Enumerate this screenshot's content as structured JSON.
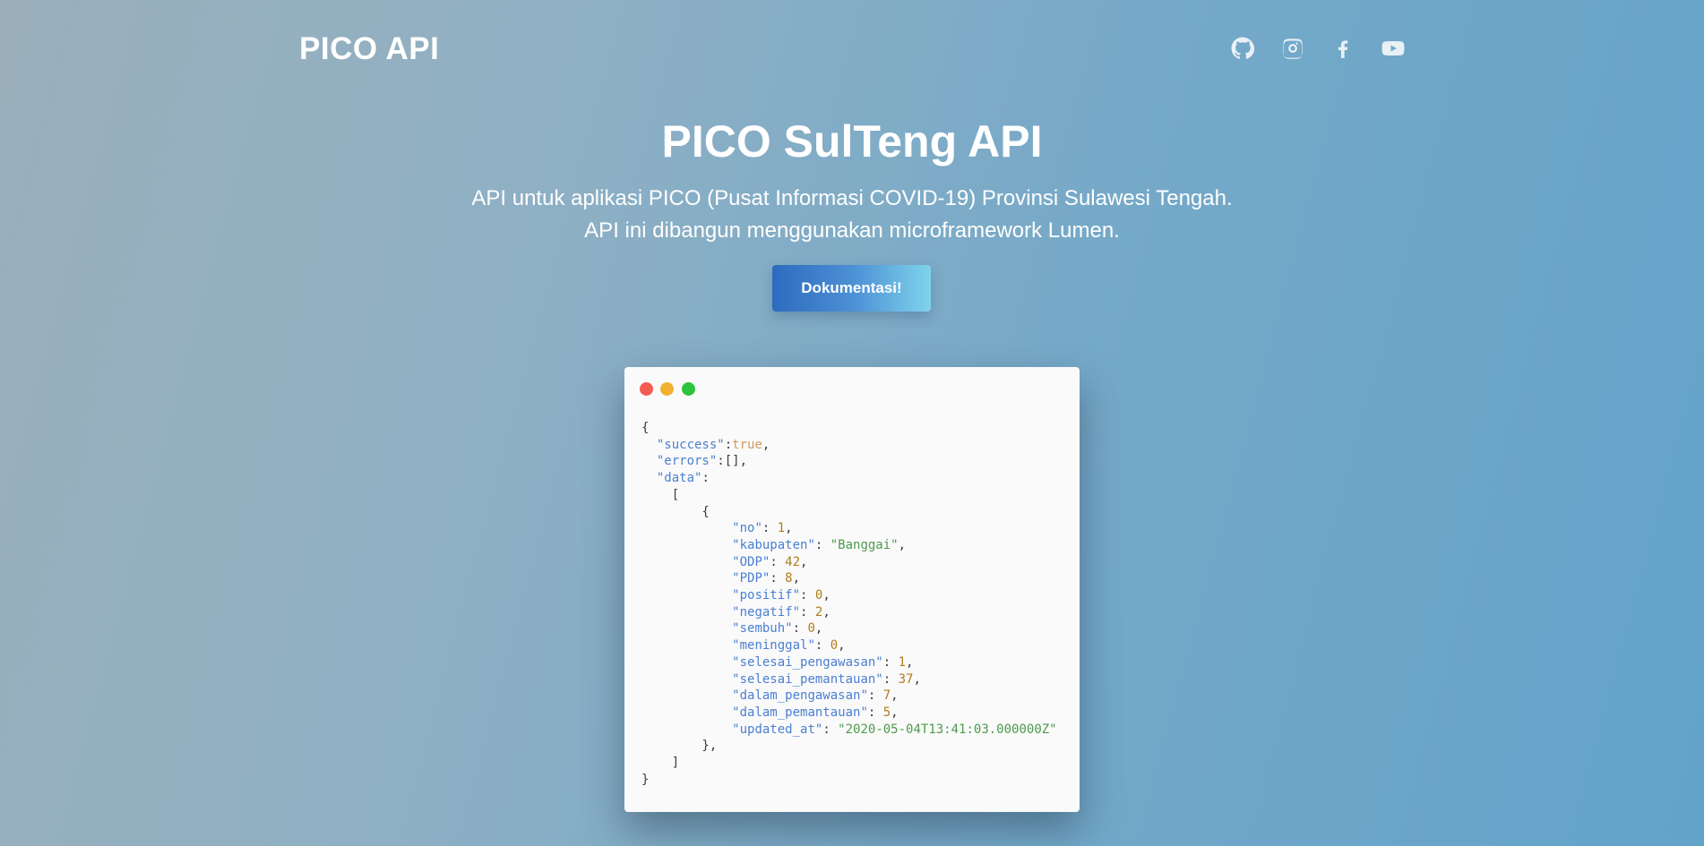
{
  "nav": {
    "brand": "PICO API",
    "social_icons": [
      "github-icon",
      "instagram-icon",
      "facebook-icon",
      "youtube-icon"
    ]
  },
  "hero": {
    "title": "PICO SulTeng API",
    "subtitle_line1": "API untuk aplikasi PICO (Pusat Informasi COVID-19) Provinsi Sulawesi Tengah.",
    "subtitle_line2": "API ini dibangun menggunakan microframework Lumen.",
    "button_label": "Dokumentasi!"
  },
  "colors": {
    "window_close": "#f45b52",
    "window_minimize": "#f0b22e",
    "window_maximize": "#2cc33d",
    "json_key": "#4a7fd0",
    "json_string": "#4d9a4d",
    "json_number": "#b07d1a",
    "json_boolean": "#d49a5a"
  },
  "code_sample": {
    "success_key": "\"success\"",
    "success_value": "true",
    "errors_key": "\"errors\"",
    "errors_value": "[]",
    "data_key": "\"data\"",
    "fields": [
      {
        "key": "\"no\"",
        "value": "1",
        "type": "number"
      },
      {
        "key": "\"kabupaten\"",
        "value": "\"Banggai\"",
        "type": "string"
      },
      {
        "key": "\"ODP\"",
        "value": "42",
        "type": "number"
      },
      {
        "key": "\"PDP\"",
        "value": "8",
        "type": "number"
      },
      {
        "key": "\"positif\"",
        "value": "0",
        "type": "number"
      },
      {
        "key": "\"negatif\"",
        "value": "2",
        "type": "number"
      },
      {
        "key": "\"sembuh\"",
        "value": "0",
        "type": "number"
      },
      {
        "key": "\"meninggal\"",
        "value": "0",
        "type": "number"
      },
      {
        "key": "\"selesai_pengawasan\"",
        "value": "1",
        "type": "number"
      },
      {
        "key": "\"selesai_pemantauan\"",
        "value": "37",
        "type": "number"
      },
      {
        "key": "\"dalam_pengawasan\"",
        "value": "7",
        "type": "number"
      },
      {
        "key": "\"dalam_pemantauan\"",
        "value": "5",
        "type": "number"
      },
      {
        "key": "\"updated_at\"",
        "value": "\"2020-05-04T13:41:03.000000Z\"",
        "type": "string"
      }
    ]
  }
}
